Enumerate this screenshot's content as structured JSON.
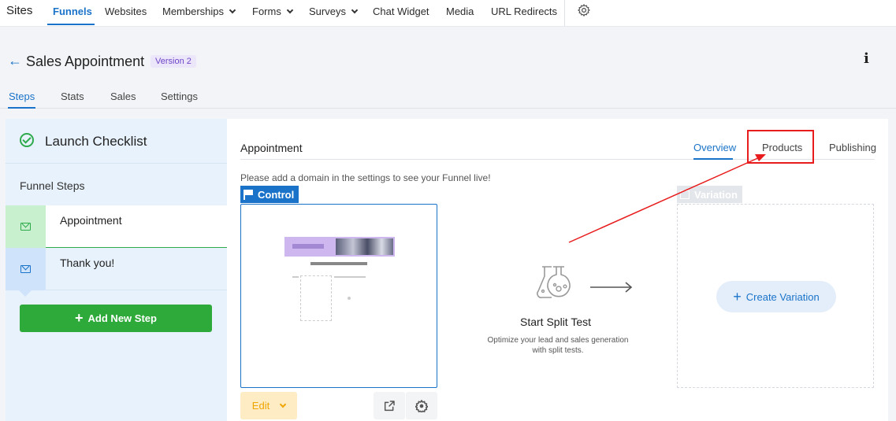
{
  "topnav": {
    "brand": "Sites",
    "items": [
      {
        "label": "Funnels",
        "active": true,
        "dropdown": false
      },
      {
        "label": "Websites",
        "dropdown": false
      },
      {
        "label": "Memberships",
        "dropdown": true
      },
      {
        "label": "Forms",
        "dropdown": true
      },
      {
        "label": "Surveys",
        "dropdown": true
      },
      {
        "label": "Chat Widget",
        "dropdown": false
      },
      {
        "label": "Media",
        "dropdown": false
      },
      {
        "label": "URL Redirects",
        "dropdown": false
      }
    ],
    "settings_icon": "gear-icon"
  },
  "header": {
    "back_icon": "arrow-left-icon",
    "title": "Sales Appointment",
    "version": "Version 2",
    "info_icon": "i",
    "tabs": [
      "Steps",
      "Stats",
      "Sales",
      "Settings"
    ],
    "active_tab": "Steps"
  },
  "sidebar": {
    "checklist_label": "Launch Checklist",
    "steps_title": "Funnel Steps",
    "steps": [
      {
        "label": "Appointment",
        "active": true
      },
      {
        "label": "Thank you!",
        "active": false
      }
    ],
    "add_step_label": "Add New Step",
    "add_step_icon": "+"
  },
  "main": {
    "step_name": "Appointment",
    "tabs": [
      "Overview",
      "Products",
      "Publishing"
    ],
    "active_tab": "Overview",
    "domain_message": "Please add a domain in the settings to see your Funnel live!",
    "control_label": "Control",
    "edit_label": "Edit",
    "split_test": {
      "title": "Start Split Test",
      "description": "Optimize your lead and sales generation with split tests."
    },
    "variation_label": "Variation",
    "create_variation_label": "Create Variation",
    "create_variation_icon": "+"
  },
  "colors": {
    "accent": "#1a73c9",
    "success": "#2eaa3a",
    "annotation": "#e81c1c",
    "edit": "#f0a500"
  }
}
